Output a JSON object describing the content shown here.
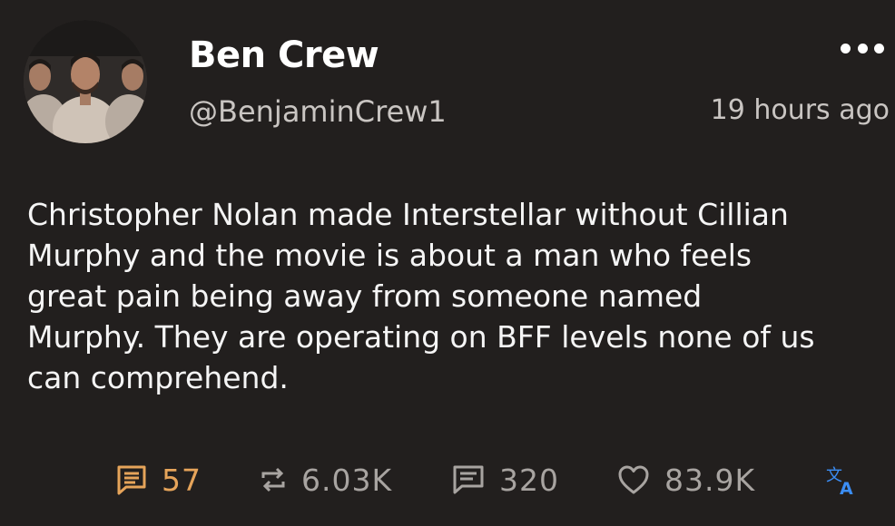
{
  "post": {
    "author_name": "Ben Crew",
    "author_handle": "@BenjaminCrew1",
    "timestamp": "19 hours ago",
    "body": "Christopher Nolan made Interstellar without Cillian\nMurphy and the movie is about a man who feels\ngreat pain being away from someone named\nMurphy. They are operating on BFF levels none of us\ncan comprehend."
  },
  "actions": {
    "replies": "57",
    "reposts": "6.03K",
    "comments": "320",
    "likes": "83.9K"
  },
  "icons": {
    "more": "more-horizontal-icon",
    "reply": "reply-icon",
    "repost": "repost-icon",
    "comment": "comment-icon",
    "like": "heart-icon",
    "translate": "translate-icon"
  },
  "colors": {
    "background": "#221f1e",
    "reply_accent": "#e6a45a",
    "translate_accent": "#3b8df5",
    "muted": "#a8a4a1"
  }
}
